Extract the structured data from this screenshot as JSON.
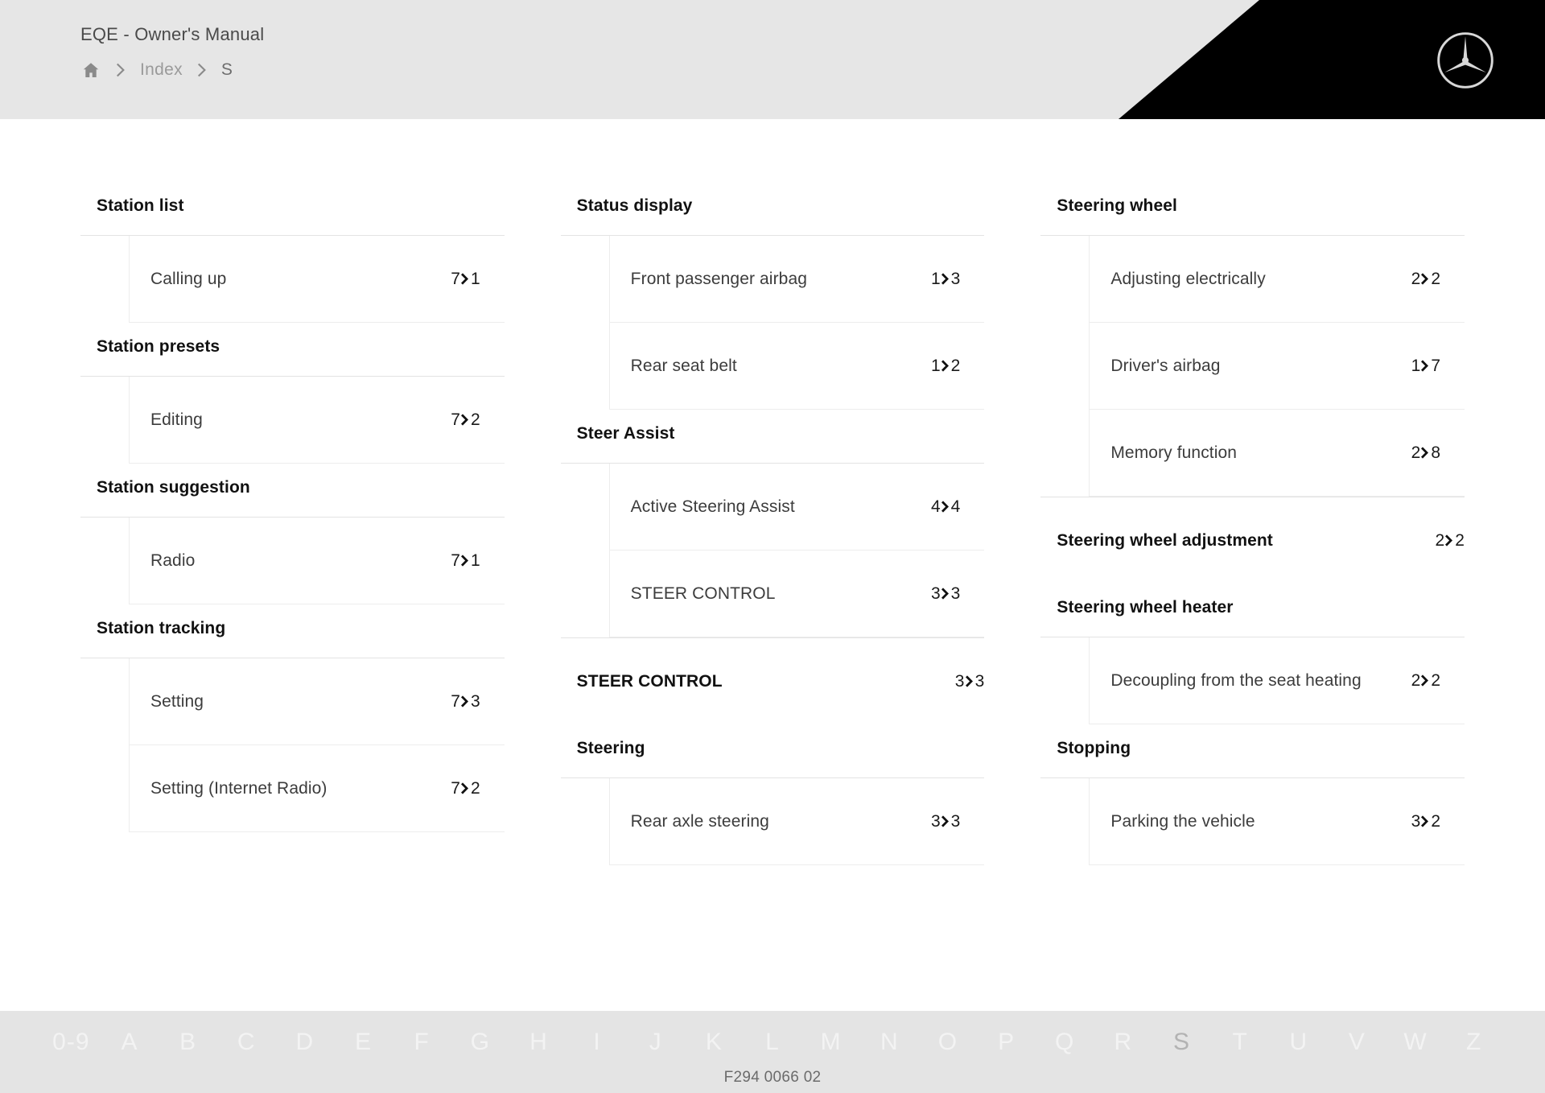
{
  "header": {
    "manual_title": "EQE - Owner's Manual",
    "breadcrumb": {
      "home_icon": "home-icon",
      "separator_icon": "chevron-right-icon",
      "index_label": "Index",
      "current_label": "S"
    },
    "logo_icon": "mercedes-benz-star-icon"
  },
  "columns": [
    {
      "groups": [
        {
          "title": "Station list",
          "ref": null,
          "entries": [
            {
              "label": "Calling up",
              "ref": {
                "chapter": "7",
                "page": "1"
              }
            }
          ]
        },
        {
          "title": "Station presets",
          "ref": null,
          "entries": [
            {
              "label": "Editing",
              "ref": {
                "chapter": "7",
                "page": "2"
              }
            }
          ]
        },
        {
          "title": "Station suggestion",
          "ref": null,
          "entries": [
            {
              "label": "Radio",
              "ref": {
                "chapter": "7",
                "page": "1"
              }
            }
          ]
        },
        {
          "title": "Station tracking",
          "ref": null,
          "entries": [
            {
              "label": "Setting",
              "ref": {
                "chapter": "7",
                "page": "3"
              }
            },
            {
              "label": "Setting (Internet Radio)",
              "ref": {
                "chapter": "7",
                "page": "2"
              }
            }
          ]
        }
      ]
    },
    {
      "groups": [
        {
          "title": "Status display",
          "ref": null,
          "entries": [
            {
              "label": "Front passenger airbag",
              "ref": {
                "chapter": "1",
                "page": "3"
              }
            },
            {
              "label": "Rear seat belt",
              "ref": {
                "chapter": "1",
                "page": "2"
              }
            }
          ]
        },
        {
          "title": "Steer Assist",
          "ref": null,
          "entries": [
            {
              "label": "Active Steering Assist",
              "ref": {
                "chapter": "4",
                "page": "4"
              }
            },
            {
              "label": "STEER CONTROL",
              "ref": {
                "chapter": "3",
                "page": "3"
              }
            }
          ]
        },
        {
          "title": "STEER CONTROL",
          "ref": {
            "chapter": "3",
            "page": "3"
          },
          "entries": []
        },
        {
          "title": "Steering",
          "ref": null,
          "entries": [
            {
              "label": "Rear axle steering",
              "ref": {
                "chapter": "3",
                "page": "3"
              }
            }
          ]
        }
      ]
    },
    {
      "groups": [
        {
          "title": "Steering wheel",
          "ref": null,
          "entries": [
            {
              "label": "Adjusting electrically",
              "ref": {
                "chapter": "2",
                "page": "2"
              }
            },
            {
              "label": "Driver's airbag",
              "ref": {
                "chapter": "1",
                "page": "7"
              }
            },
            {
              "label": "Memory function",
              "ref": {
                "chapter": "2",
                "page": "8"
              }
            }
          ]
        },
        {
          "title": "Steering wheel adjustment",
          "ref": {
            "chapter": "2",
            "page": "2"
          },
          "entries": []
        },
        {
          "title": "Steering wheel heater",
          "ref": null,
          "entries": [
            {
              "label": "Decoupling from the seat heating",
              "ref": {
                "chapter": "2",
                "page": "2"
              }
            }
          ]
        },
        {
          "title": "Stopping",
          "ref": null,
          "entries": [
            {
              "label": "Parking the vehicle",
              "ref": {
                "chapter": "3",
                "page": "2"
              }
            }
          ]
        }
      ]
    }
  ],
  "alphabet_bar": {
    "letters": [
      "0-9",
      "A",
      "B",
      "C",
      "D",
      "E",
      "F",
      "G",
      "H",
      "I",
      "J",
      "K",
      "L",
      "M",
      "N",
      "O",
      "P",
      "Q",
      "R",
      "S",
      "T",
      "U",
      "V",
      "W",
      "Z"
    ],
    "active": "S"
  },
  "footer": {
    "document_reference": "F294 0066 02"
  },
  "colors": {
    "header_bg": "#e6e6e6",
    "header_accent": "#000000",
    "page_bg": "#ffffff",
    "alphabar_bg": "#e4e4e4",
    "text_primary": "#111111",
    "text_secondary": "#3c3c3c",
    "text_muted": "#9a9a9a",
    "rule": "#e3e3e3"
  }
}
